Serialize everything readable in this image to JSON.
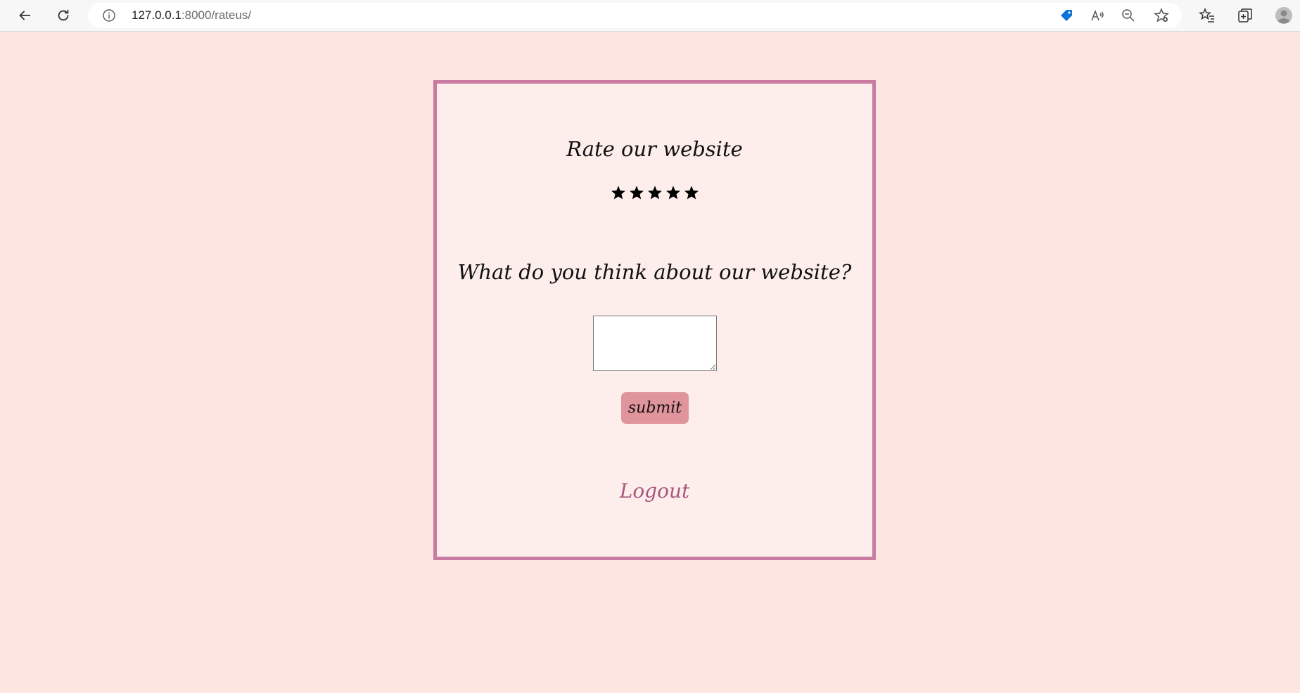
{
  "browser": {
    "url_host": "127.0.0.1",
    "url_rest": ":8000/rateus/",
    "icons": {
      "back": "back-arrow-icon",
      "reload": "reload-icon",
      "info": "info-icon",
      "shopping": "shopping-tag-icon",
      "read_aloud": "read-aloud-icon",
      "zoom": "zoom-out-icon",
      "add_favorite": "add-favorite-icon",
      "favorites": "favorites-icon",
      "collections": "collections-icon",
      "profile": "profile-avatar-icon"
    },
    "accent_color": "#0b74d6"
  },
  "page": {
    "background_color": "#fde5e1",
    "card_color": "#fdeeec",
    "card_border_color": "#c97ba1",
    "rate_title": "Rate our website",
    "rating": {
      "max_stars": 5,
      "star_glyph": "★"
    },
    "question": "What do you think about our website?",
    "feedback_value": "",
    "submit_label": "submit",
    "submit_color": "#e0959c",
    "logout_label": "Logout",
    "logout_color": "#a8577e"
  }
}
